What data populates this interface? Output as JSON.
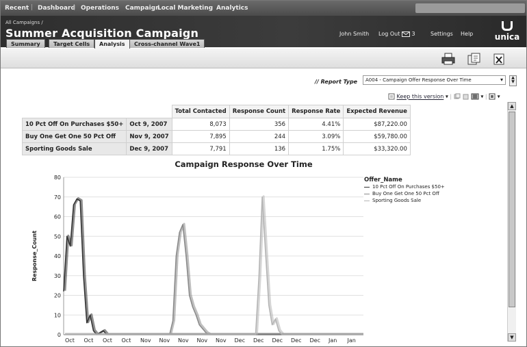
{
  "topnav": {
    "items": [
      "Recent",
      "Dashboard",
      "Operations",
      "Campaign",
      "Local Marketing",
      "Analytics"
    ]
  },
  "header": {
    "breadcrumb": "All Campaigns /",
    "title": "Summer Acquisition Campaign",
    "user": "John Smith",
    "logout": "Log Out",
    "mail_count": "3",
    "settings": "Settings",
    "help": "Help",
    "logo": "unica"
  },
  "tabs": [
    "Summary",
    "Target Cells",
    "Analysis",
    "Cross-channel Wave1"
  ],
  "active_tab": "Analysis",
  "report": {
    "type_label": "// Report Type",
    "type_value": "A004 - Campaign Offer Response Over Time",
    "keep_version": "Keep this version"
  },
  "table": {
    "headers": [
      "Total Contacted",
      "Response Count",
      "Response Rate",
      "Expected Revenue"
    ],
    "rows": [
      {
        "name": "10 Pct Off On Purchases $50+",
        "date": "Oct 9, 2007",
        "contacted": "8,073",
        "count": "356",
        "rate": "4.41%",
        "revenue": "$87,220.00"
      },
      {
        "name": "Buy One Get One 50 Pct Off",
        "date": "Nov 9, 2007",
        "contacted": "7,895",
        "count": "244",
        "rate": "3.09%",
        "revenue": "$59,780.00"
      },
      {
        "name": "Sporting Goods Sale",
        "date": "Dec 9, 2007",
        "contacted": "7,791",
        "count": "136",
        "rate": "1.75%",
        "revenue": "$33,320.00"
      }
    ]
  },
  "chart_data": {
    "type": "line",
    "title": "Campaign Response Over Time",
    "ylabel": "Response_Count",
    "xlabel": "",
    "ylim": [
      0,
      80
    ],
    "yticks": [
      0,
      10,
      20,
      30,
      40,
      50,
      60,
      70,
      80
    ],
    "xticks": [
      "Oct",
      "Oct",
      "Oct",
      "Oct",
      "Nov",
      "Nov",
      "Nov",
      "Nov",
      "Nov",
      "Dec",
      "Dec",
      "Dec",
      "Dec",
      "Dec",
      "Jan",
      "Jan"
    ],
    "grid": true,
    "legend_title": "Offer_Name",
    "legend_position": "right",
    "series": [
      {
        "name": "10 Pct Off On Purchases $50+",
        "color": "#333333",
        "values": [
          22,
          50,
          45,
          66,
          69,
          68,
          30,
          6,
          10,
          2,
          0,
          1,
          2,
          0,
          0,
          0,
          0,
          0,
          0,
          0,
          0,
          0,
          0,
          0,
          0,
          0,
          0,
          0,
          0,
          0,
          0,
          0,
          0,
          0,
          0,
          0,
          0,
          0,
          0,
          0,
          0,
          0,
          0,
          0,
          0,
          0,
          0,
          0,
          0,
          0,
          0,
          0,
          0,
          0,
          0,
          0,
          0,
          0,
          0,
          0,
          0,
          0,
          0,
          0,
          0,
          0,
          0,
          0,
          0,
          0,
          0,
          0,
          0,
          0,
          0,
          0,
          0,
          0,
          0,
          0,
          0,
          0,
          0,
          0,
          0,
          0,
          0,
          0,
          0,
          0,
          0,
          0
        ]
      },
      {
        "name": "Buy One Get One 50 Pct Off",
        "color": "#8a8a8a",
        "values": [
          0,
          0,
          0,
          0,
          0,
          0,
          0,
          0,
          0,
          0,
          0,
          0,
          0,
          0,
          0,
          0,
          0,
          0,
          0,
          0,
          0,
          0,
          0,
          0,
          0,
          0,
          0,
          0,
          0,
          0,
          0,
          0,
          0,
          7,
          40,
          52,
          56,
          40,
          20,
          14,
          10,
          5,
          3,
          1,
          0,
          0,
          0,
          0,
          0,
          0,
          0,
          0,
          0,
          0,
          0,
          0,
          0,
          0,
          0,
          0,
          0,
          0,
          0,
          0,
          0,
          0,
          0,
          0,
          0,
          0,
          0,
          0,
          0,
          0,
          0,
          0,
          0,
          0,
          0,
          0,
          0,
          0,
          0,
          0,
          0,
          0,
          0,
          0,
          0,
          0,
          0,
          0
        ]
      },
      {
        "name": "Sporting Goods Sale",
        "color": "#b5b5b5",
        "values": [
          0,
          0,
          0,
          0,
          0,
          0,
          0,
          0,
          0,
          0,
          0,
          0,
          0,
          0,
          0,
          0,
          0,
          0,
          0,
          0,
          0,
          0,
          0,
          0,
          0,
          0,
          0,
          0,
          0,
          0,
          0,
          0,
          0,
          0,
          0,
          0,
          0,
          0,
          0,
          0,
          0,
          0,
          0,
          0,
          0,
          0,
          0,
          0,
          0,
          0,
          0,
          0,
          0,
          0,
          0,
          0,
          0,
          0,
          0,
          29,
          70,
          42,
          15,
          5,
          8,
          2,
          0,
          0,
          0,
          0,
          0,
          0,
          0,
          0,
          0,
          0,
          0,
          0,
          0,
          0,
          0,
          0,
          0,
          0,
          0,
          0,
          0,
          0,
          0,
          0,
          0,
          0
        ]
      }
    ]
  }
}
